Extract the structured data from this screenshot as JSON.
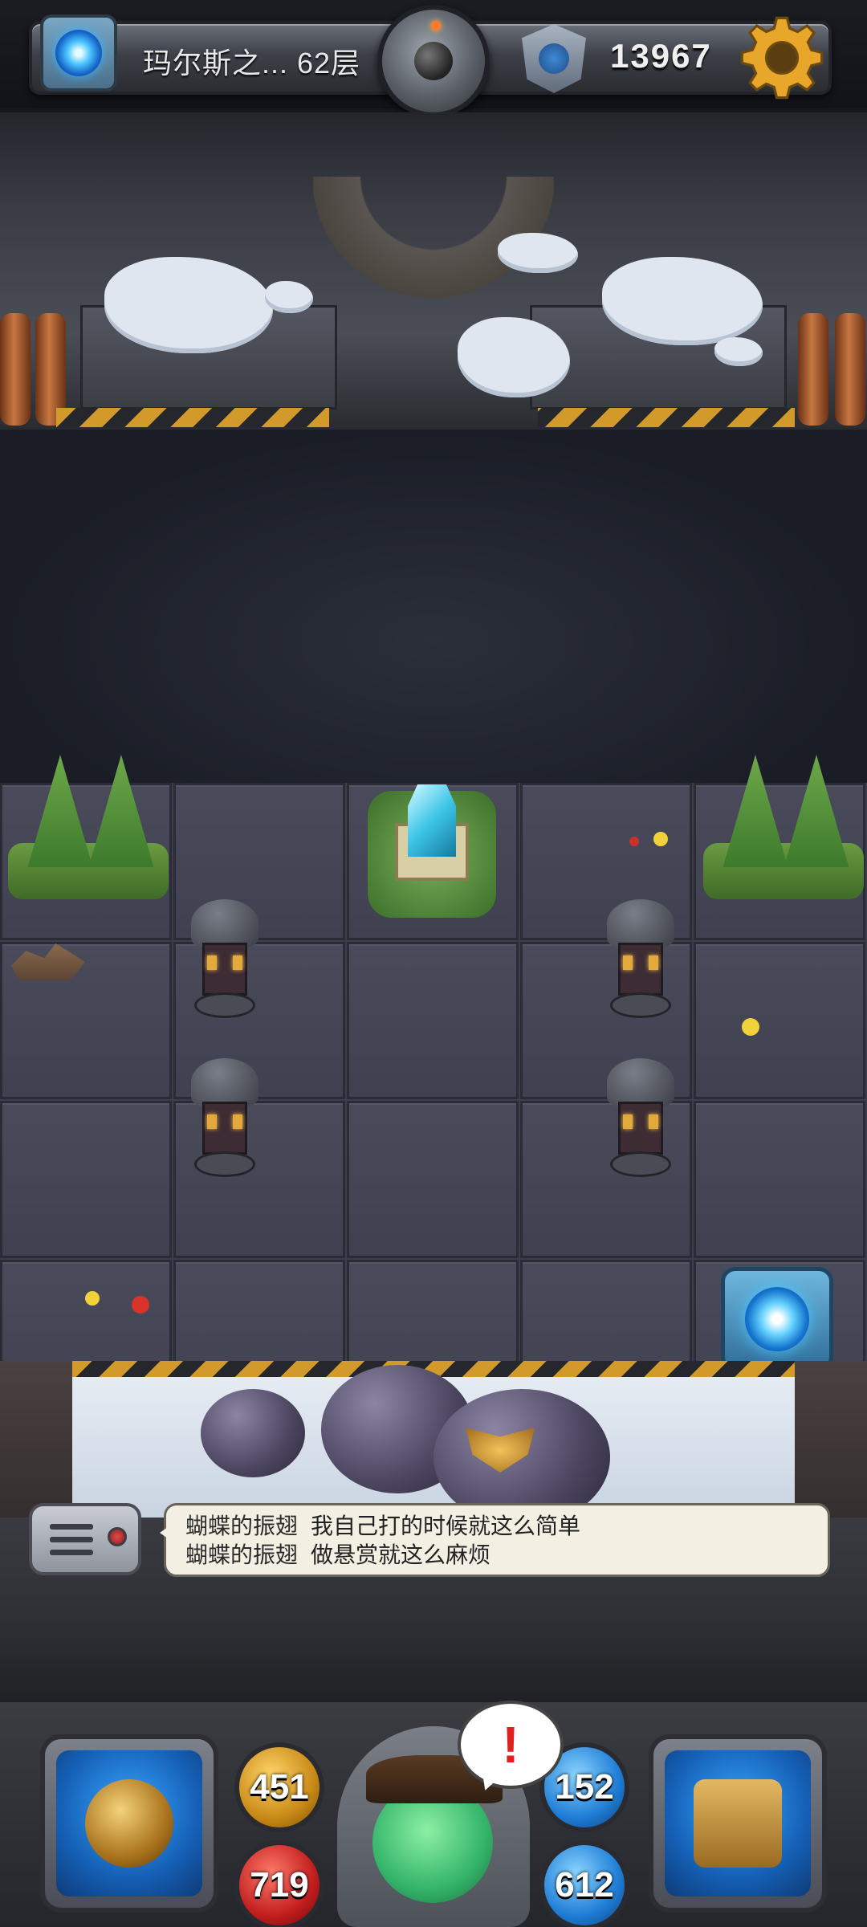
{
  "header": {
    "floor_label": "玛尔斯之... 62层",
    "gold": "13967"
  },
  "chat": {
    "messages": [
      {
        "sender": "蝴蝶的振翅",
        "text": "我自己打的时候就这么简单"
      },
      {
        "sender": "蝴蝶的振翅",
        "text": "做悬赏就这么麻烦"
      }
    ]
  },
  "stats": {
    "attack": "451",
    "hp": "719",
    "defense": "152",
    "mp": "612"
  },
  "alert": {
    "symbol": "!"
  },
  "colors": {
    "accent_gold": "#d19a2a",
    "portal_blue": "#4ac6ff",
    "alert_red": "#e02020"
  },
  "icons": [
    "portal-icon",
    "bomb-icon",
    "badge-icon",
    "gear-icon",
    "back-arrow-icon",
    "record-icon",
    "chat-icon",
    "alert-icon",
    "sword-icon",
    "shield-icon",
    "spellbook-icon"
  ]
}
